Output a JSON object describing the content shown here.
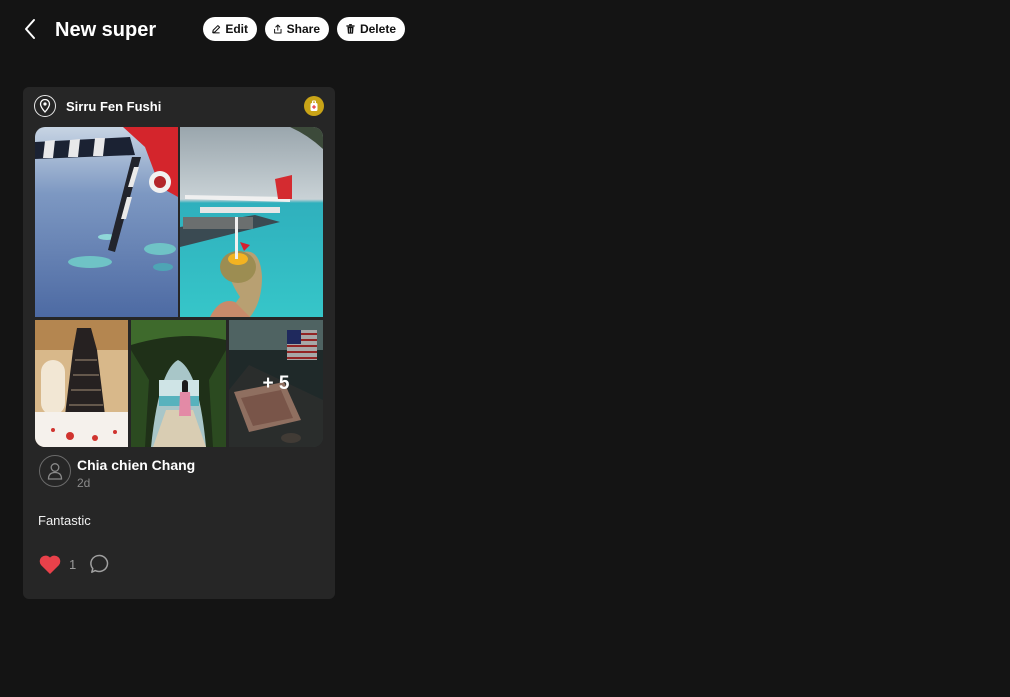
{
  "header": {
    "title": "New super",
    "buttons": {
      "edit": "Edit",
      "share": "Share",
      "delete": "Delete"
    }
  },
  "post": {
    "location": "Sirru Fen Fushi",
    "photos": [
      {
        "icon": "seaplane-wing-photo"
      },
      {
        "icon": "seaplane-coconut-photo"
      },
      {
        "icon": "dress-room-photo"
      },
      {
        "icon": "beach-path-photo"
      },
      {
        "icon": "table-flag-photo"
      }
    ],
    "more_photos": "+ 5",
    "author": {
      "name": "Chia chien Chang",
      "time": "2d"
    },
    "caption": "Fantastic",
    "likes": "1",
    "colors": {
      "heart": "#e8414a",
      "badge": "#c9a417"
    }
  }
}
